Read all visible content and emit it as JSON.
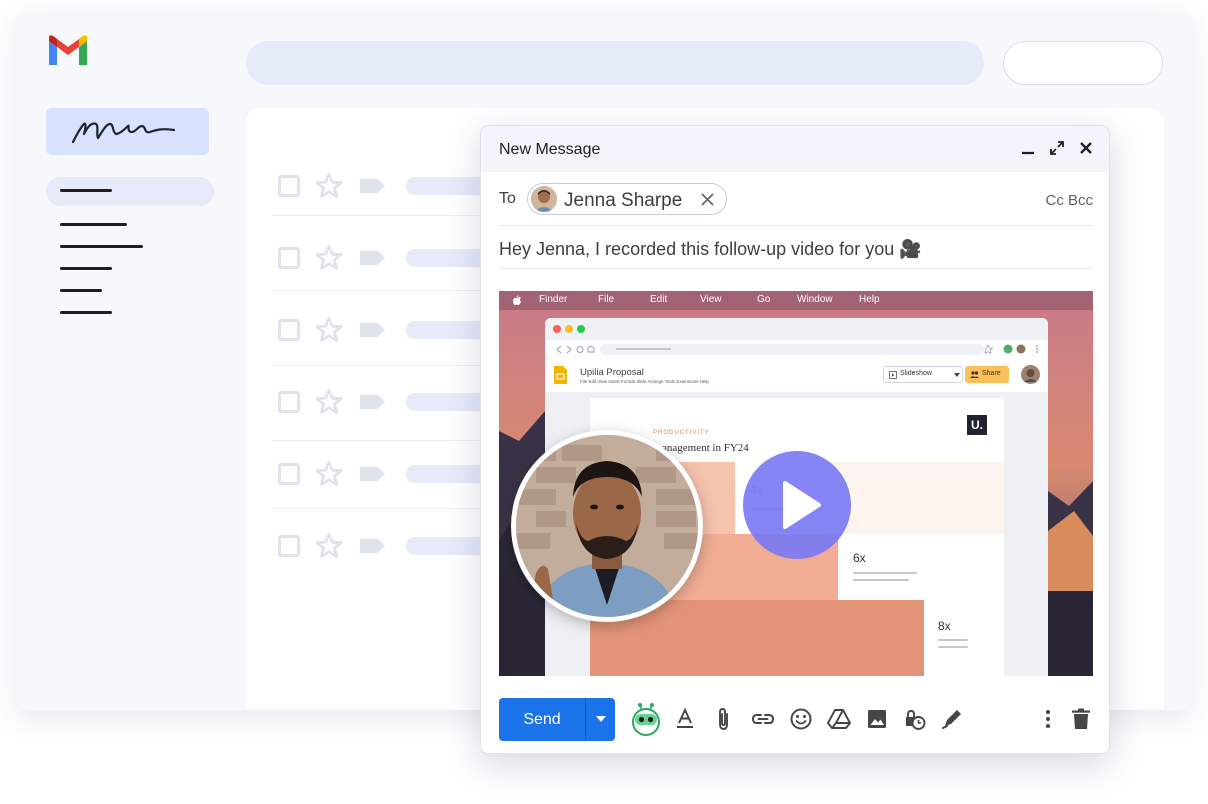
{
  "compose": {
    "title": "New Message",
    "to_label": "To",
    "recipient": "Jenna Sharpe",
    "cc_bcc": "Cc Bcc",
    "subject": "Hey Jenna, I recorded this follow-up video for you 🎥"
  },
  "video": {
    "menubar": [
      "Finder",
      "File",
      "Edit",
      "View",
      "Go",
      "Window",
      "Help"
    ],
    "doc_title": "Upilia Proposal",
    "doc_menus": "File  Edit  View  Insert  Format  Slide  Arrange  Tools  Extensions  Help",
    "slideshow_label": "Slideshow",
    "share_label": "Share",
    "slide_kicker": "PRODUCTIVITY",
    "slide_heading": "anagement in FY24",
    "logo_letter": "U.",
    "multipliers": [
      "4x",
      "6x",
      "8x"
    ]
  },
  "footer": {
    "send_label": "Send",
    "icons": [
      "loom-icon",
      "text-format-icon",
      "attach-icon",
      "link-icon",
      "emoji-icon",
      "drive-icon",
      "image-icon",
      "schedule-icon",
      "signature-icon",
      "more-icon",
      "trash-icon"
    ]
  },
  "colors": {
    "accent": "#1a73e8",
    "play": "#7a78f5",
    "sidebar": "#e6ebfa"
  }
}
